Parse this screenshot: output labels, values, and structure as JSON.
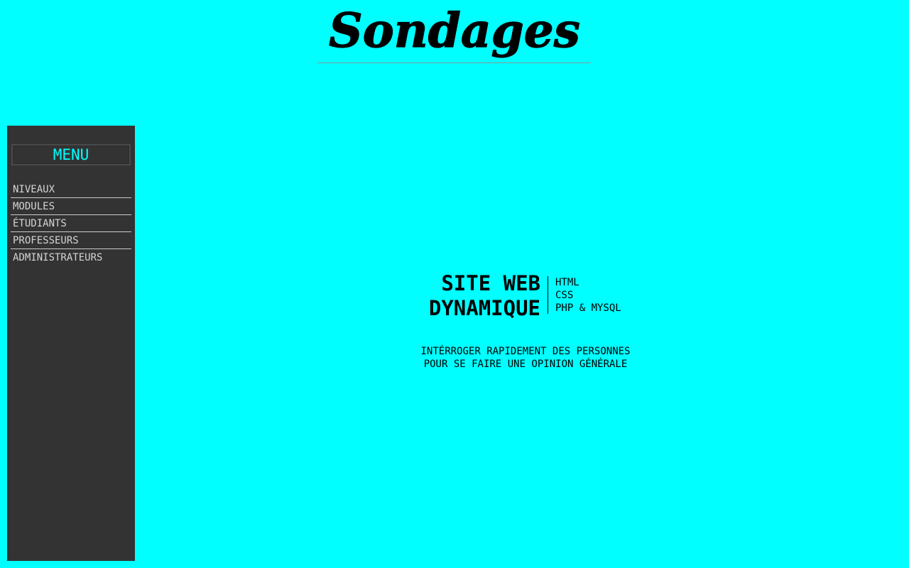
{
  "header": {
    "logo_text": "Sondages"
  },
  "sidebar": {
    "title": "MENU",
    "items": [
      {
        "label": "NIVEAUX"
      },
      {
        "label": "MODULES"
      },
      {
        "label": "ÉTUDIANTS"
      },
      {
        "label": "PROFESSEURS"
      },
      {
        "label": "ADMINISTRATEURS"
      }
    ]
  },
  "hero": {
    "title_line1": "SITE WEB",
    "title_line2": "DYNAMIQUE",
    "tech": [
      "HTML",
      "CSS",
      "PHP & MYSQL"
    ]
  },
  "tagline": {
    "line1": "INTÉRROGER RAPIDEMENT DES PERSONNES",
    "line2": "POUR SE FAIRE UNE OPINION GÉNÉRALE"
  },
  "colors": {
    "background": "#00ffff",
    "sidebar": "#333333",
    "menu_title": "#00ffff",
    "menu_item": "#d4d4d4"
  }
}
